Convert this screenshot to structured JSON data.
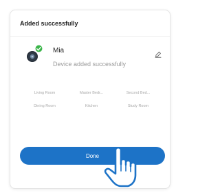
{
  "dialog": {
    "title": "Added successfully",
    "device": {
      "name": "Mia",
      "status": "Device added successfully",
      "icon": "smart-speaker-icon",
      "badge_icon": "check-circle-icon",
      "badge_color": "#3bb54a",
      "edit_icon": "pencil-icon"
    },
    "rooms": [
      "Living Room",
      "Master Bedr...",
      "Second Bed...",
      "Dining Room",
      "Kitchen",
      "Study Room"
    ],
    "done_label": "Done",
    "accent_color": "#1d73c7"
  }
}
